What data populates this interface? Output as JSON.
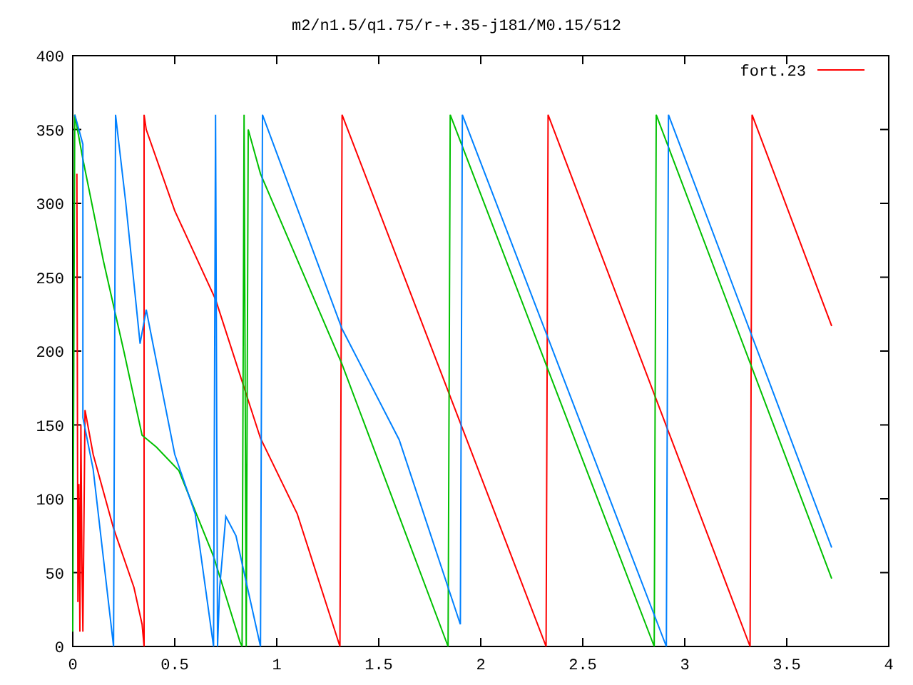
{
  "chart": {
    "chart_data": {
      "type": "line",
      "title": "m2/n1.5/q1.75/r-+.35-j181/M0.15/512",
      "xlim": [
        0,
        4
      ],
      "ylim": [
        0,
        400
      ],
      "xticks": [
        0,
        {
          "value": 0.5,
          "label": "0.5"
        },
        1,
        {
          "value": 1.5,
          "label": "1.5"
        },
        2,
        {
          "value": 2.5,
          "label": "2.5"
        },
        3,
        {
          "value": 3.5,
          "label": "3.5"
        },
        4
      ],
      "yticks": [
        0,
        50,
        100,
        150,
        200,
        250,
        300,
        350,
        400
      ],
      "series": [
        {
          "name": "fort.23",
          "color": "#ff0000",
          "x": [
            0.02,
            0.025,
            0.03,
            0.035,
            0.04,
            0.045,
            0.05,
            0.06,
            0.1,
            0.2,
            0.3,
            0.34,
            0.35,
            0.35,
            0.36,
            0.5,
            0.7,
            0.92,
            1.1,
            1.31,
            1.32,
            2.32,
            2.33,
            3.32,
            3.33,
            3.72
          ],
          "values": [
            320,
            30,
            110,
            10,
            150,
            60,
            10,
            160,
            130,
            80,
            40,
            15,
            0,
            360,
            350,
            295,
            235,
            141,
            90,
            0,
            360,
            0,
            360,
            0,
            360,
            217
          ]
        },
        {
          "color": "#00c000",
          "x": [
            0.0,
            0.01,
            0.05,
            0.15,
            0.25,
            0.34,
            0.41,
            0.52,
            0.69,
            0.82,
            0.83,
            0.84,
            0.85,
            0.86,
            0.92,
            1.32,
            1.84,
            1.85,
            2.85,
            2.86,
            3.72
          ],
          "values": [
            10,
            360,
            330,
            261,
            200,
            143,
            135,
            119,
            61,
            3,
            0,
            360,
            0,
            350,
            320,
            191,
            0,
            360,
            0,
            360,
            46
          ]
        },
        {
          "color": "#0080ff",
          "x": [
            0.01,
            0.02,
            0.05,
            0.05,
            0.1,
            0.2,
            0.21,
            0.26,
            0.33,
            0.36,
            0.4,
            0.5,
            0.6,
            0.69,
            0.7,
            0.71,
            0.72,
            0.75,
            0.8,
            0.92,
            0.93,
            1.32,
            1.6,
            1.9,
            1.91,
            2.91,
            2.92,
            3.72
          ],
          "values": [
            360,
            355,
            340,
            155,
            120,
            0,
            360,
            300,
            205,
            228,
            200,
            130,
            90,
            0,
            360,
            0,
            40,
            88,
            75,
            0,
            360,
            215,
            140,
            15,
            360,
            0,
            360,
            67
          ]
        }
      ]
    }
  }
}
